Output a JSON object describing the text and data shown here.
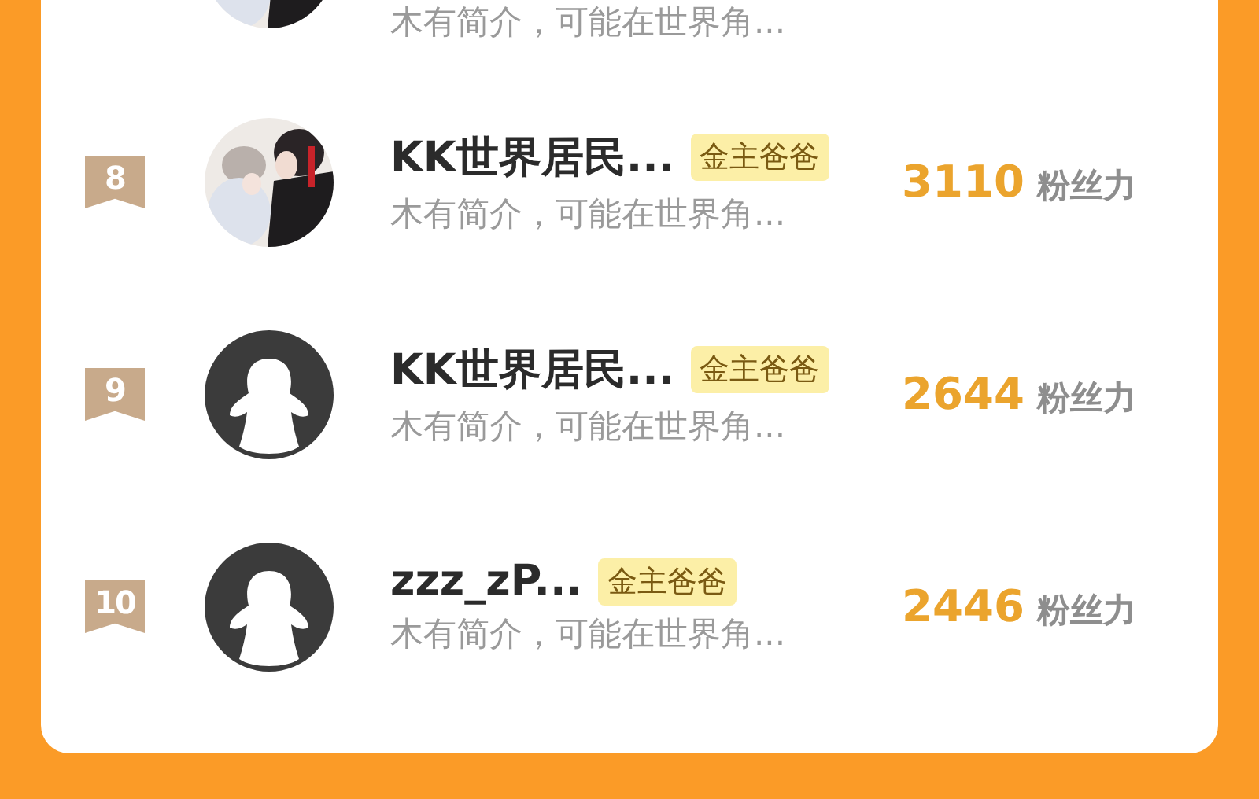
{
  "ranking": [
    {
      "bio": "木有简介，可能在世界角..."
    },
    {
      "rank": "8",
      "name": "KK世界居民...",
      "tag": "金主爸爸",
      "score": "3110",
      "score_unit": "粉丝力",
      "bio": "木有简介，可能在世界角..."
    },
    {
      "rank": "9",
      "avatar": {
        "kind": "default"
      },
      "name": "KK世界居民...",
      "tag": "金主爸爸",
      "score": "2644",
      "score_unit": "粉丝力",
      "bio": "木有简介，可能在世界角..."
    },
    {
      "rank": "10",
      "avatar": {
        "kind": "default"
      },
      "name": "zzz_zP...",
      "tag": "金主爸爸",
      "score": "2446",
      "score_unit": "粉丝力",
      "bio": "木有简介，可能在世界角..."
    }
  ]
}
